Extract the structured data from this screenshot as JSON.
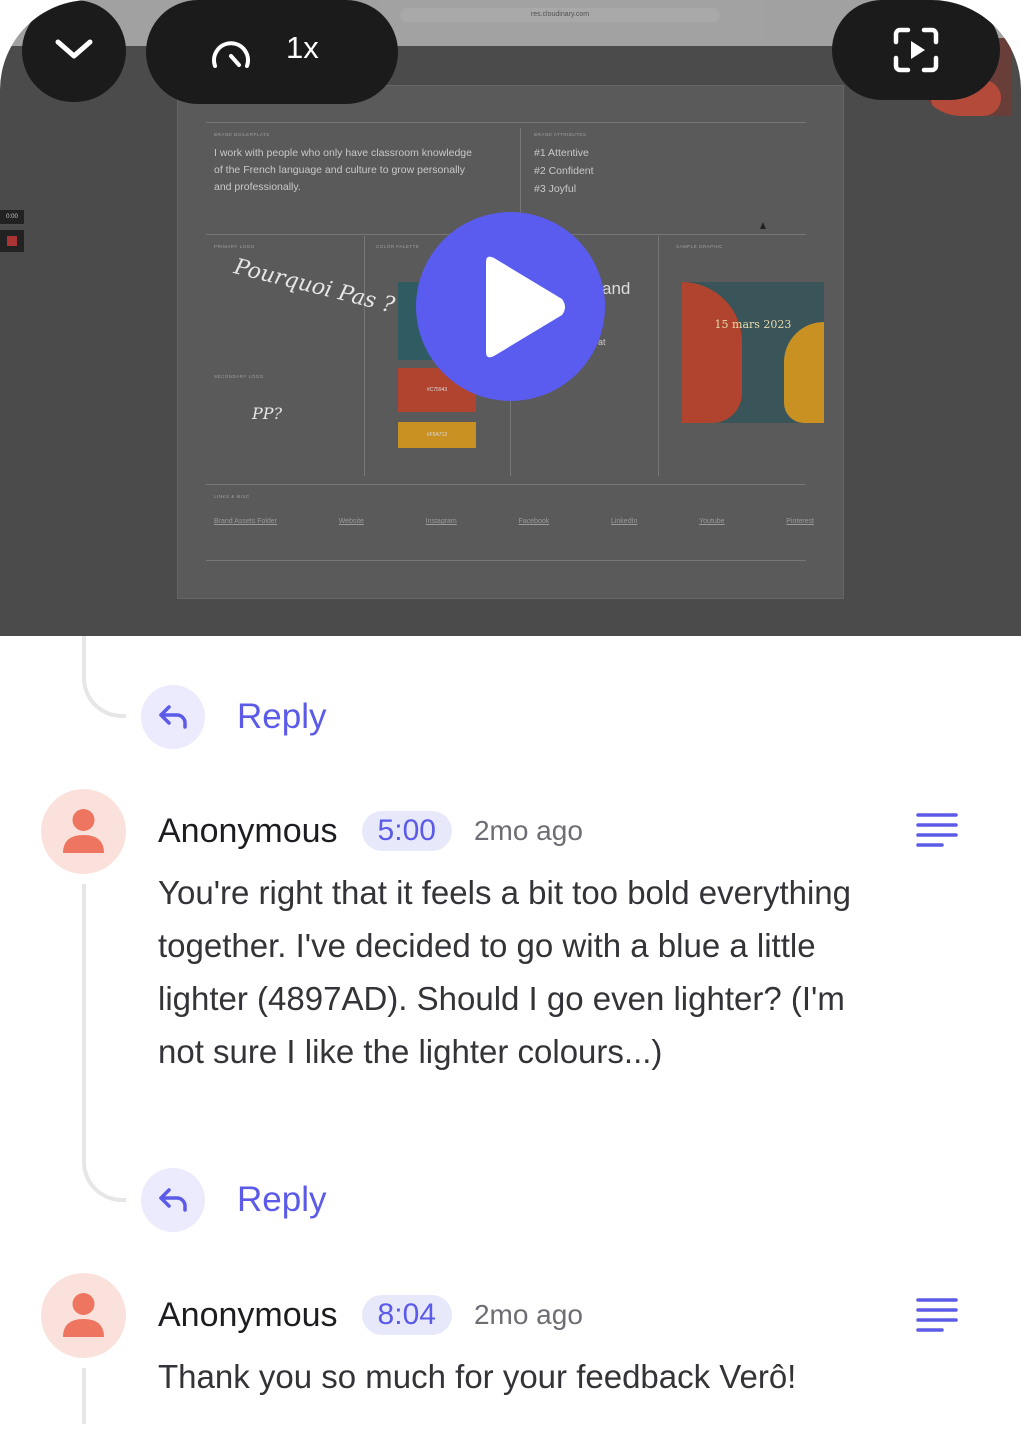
{
  "player": {
    "speed_label": "1x",
    "browser_url": "res.cloudinary.com",
    "side_time": "0:00"
  },
  "video_content": {
    "bio": "I work with people who only have classroom knowledge of the French language and culture to grow personally and professionally.",
    "attributes": [
      "#1 Attentive",
      "#2 Confident",
      "#3 Joyful"
    ],
    "brand_partial": "and",
    "brand_partial2": "at",
    "swatches": [
      {
        "label": "",
        "color": "#2f5b63"
      },
      {
        "label": "#C75943",
        "color": "#b0442f"
      },
      {
        "label": "#F5A712",
        "color": "#c99022"
      }
    ],
    "sample_date": "15 mars 2023",
    "logo_text": "Pourquoi Pas ?",
    "small_logo_text": "PP?",
    "links": [
      "Brand Assets Folder",
      "Website",
      "Instagram",
      "Facebook",
      "LinkedIn",
      "Youtube",
      "Pinterest"
    ],
    "captions": [
      "BRAND BOILERPLATE",
      "BRAND ATTRIBUTES",
      "PRIMARY LOGO",
      "COLOR PALETTE",
      "SAMPLE GRAPHIC",
      "SECONDARY LOGO",
      "LINKS & MISC"
    ]
  },
  "replies": [
    {
      "label": "Reply"
    },
    {
      "label": "Reply"
    }
  ],
  "comments": [
    {
      "author": "Anonymous",
      "timestamp": "5:00",
      "ago": "2mo ago",
      "body": "You're right that it feels a bit too bold everything together. I've decided to go with a blue a little lighter (4897AD). Should I go even lighter?  (I'm not sure I like the lighter colours...)"
    },
    {
      "author": "Anonymous",
      "timestamp": "8:04",
      "ago": "2mo ago",
      "body": "Thank you so much for your feedback Verô!"
    }
  ],
  "colors": {
    "accent": "#5b5be8",
    "play_button": "#5a5cf0",
    "avatar_bg": "#fbe1db",
    "avatar_fg": "#ee7560"
  }
}
